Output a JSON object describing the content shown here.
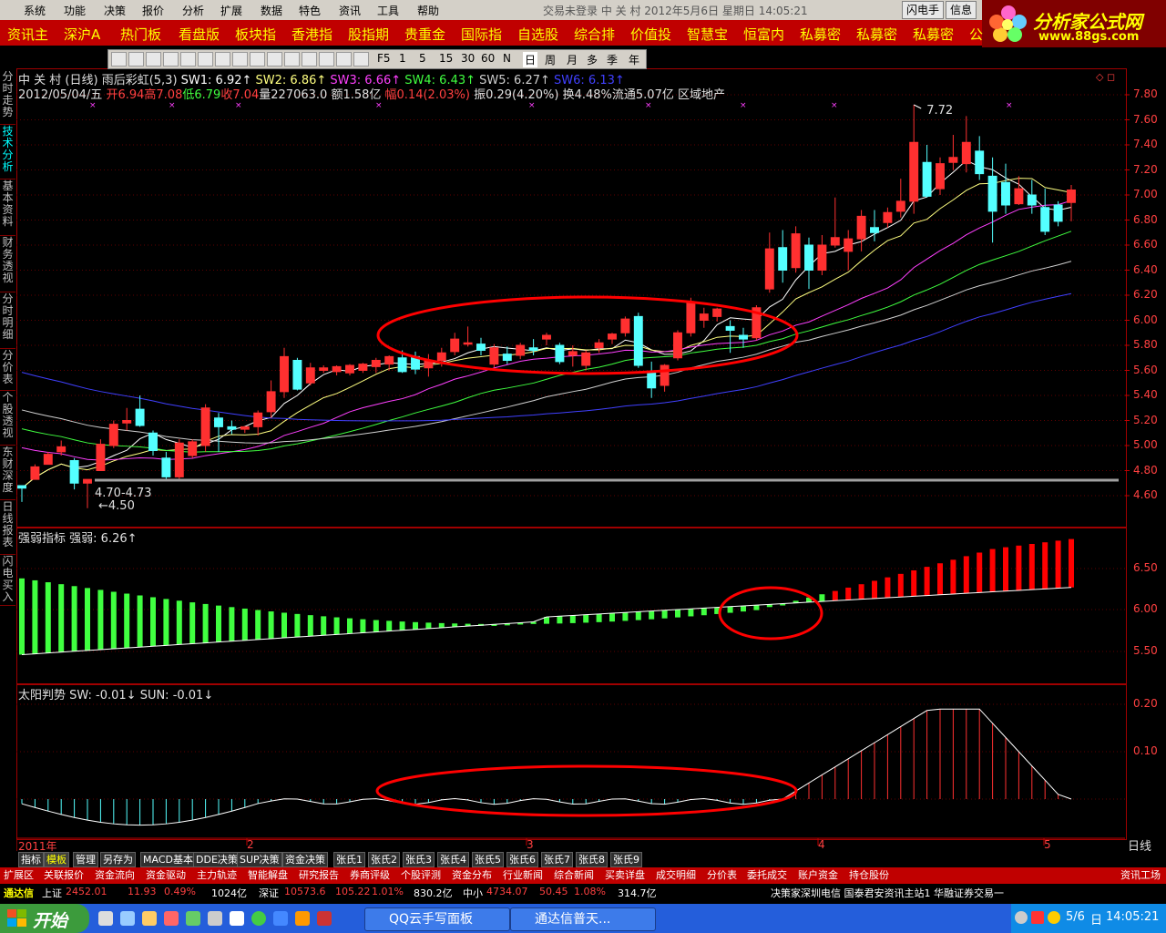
{
  "menu": {
    "items": [
      "系统",
      "功能",
      "决策",
      "报价",
      "分析",
      "扩展",
      "数据",
      "特色",
      "资讯",
      "工具",
      "帮助"
    ],
    "title": "交易未登录  中 关 村  2012年5月6日  星期日  14:05:21",
    "btn_flash": "闪电手",
    "btn_info": "信息"
  },
  "banner": {
    "items": [
      "资讯主",
      "深沪A",
      "热门板",
      "看盘版",
      "板块指",
      "香港指",
      "股指期",
      "贵重金",
      "国际指",
      "自选股",
      "综合排",
      "价值投",
      "智慧宝",
      "恒富内",
      "私募密",
      "私募密",
      "私募密",
      "公"
    ]
  },
  "logo": {
    "name": "分析家公式网",
    "url": "www.88gs.com"
  },
  "left_tabs": [
    "分时走势",
    "技术分析",
    "基本资料",
    "财务透视",
    "分时明细",
    "分价表",
    "个股透视",
    "东财深度",
    "日线报表",
    "闪电买入"
  ],
  "main_info": {
    "line1": {
      "stock": "中 关 村",
      "period": "(日线)",
      "indicator": "雨后彩虹(5,3)",
      "sw1": "SW1: 6.92↑",
      "sw2": "SW2: 6.86↑",
      "sw3": "SW3: 6.66↑",
      "sw4": "SW4: 6.43↑",
      "sw5": "SW5: 6.27↑",
      "sw6": "SW6: 6.13↑"
    },
    "line2": {
      "date": "2012/05/04/五",
      "open": "开6.94",
      "high": "高7.08",
      "low": "低6.79",
      "close": "收7.04",
      "vol": "量227063.0",
      "amount": "额1.58亿",
      "range": "幅0.14(2.03%)",
      "amp": "振0.29(4.20%)",
      "turn": "换4.48%",
      "float": "流通5.07亿",
      "sector": "区域地产"
    },
    "annot_high": "7.72",
    "annot_range": "4.70-4.73",
    "annot_low": "4.50"
  },
  "price_axis": [
    "7.80",
    "7.60",
    "7.40",
    "7.20",
    "7.00",
    "6.80",
    "6.60",
    "6.40",
    "6.20",
    "6.00",
    "5.80",
    "5.60",
    "5.40",
    "5.20",
    "5.00",
    "4.80",
    "4.60"
  ],
  "toolbar": [
    "F5",
    "1",
    "5",
    "15",
    "30",
    "60",
    "N",
    "日",
    "周",
    "月",
    "多",
    "季",
    "年"
  ],
  "strength": {
    "title": "强弱指标",
    "value": "强弱: 6.26↑",
    "axis": [
      "6.50",
      "6.00",
      "5.50"
    ]
  },
  "sun": {
    "title": "太阳判势",
    "sw": "SW: -0.01↓",
    "sun": "SUN: -0.01↓",
    "axis": [
      "0.20",
      "0.10"
    ]
  },
  "xaxis": {
    "labels": [
      "2011年",
      "2",
      "3",
      "4",
      "5"
    ],
    "corner": "日线"
  },
  "tabs1": [
    "指标",
    "模板",
    "管理",
    "另存为",
    "MACD基本",
    "DDE决策",
    "SUP决策",
    "资金决策",
    "张氏1",
    "张氏2",
    "张氏3",
    "张氏4",
    "张氏5",
    "张氏6",
    "张氏7",
    "张氏8",
    "张氏9"
  ],
  "tabs2": [
    "扩展区",
    "关联报价",
    "资金流向",
    "资金驱动",
    "主力轨迹",
    "智能解盘",
    "研究报告",
    "券商评级",
    "个股评测",
    "资金分布",
    "行业新闻",
    "综合新闻",
    "买卖详盘",
    "成交明细",
    "分价表",
    "委托成交",
    "账户资金",
    "持仓股份",
    "资讯工场"
  ],
  "status": {
    "brand": "通达信",
    "sh": "上证",
    "sh_val": "2452.01",
    "sh_chg": "11.93",
    "sh_pct": "0.49%",
    "sh_amt": "1024亿",
    "sz": "深证",
    "sz_val": "10573.6",
    "sz_chg": "105.22",
    "sz_pct": "1.01%",
    "sz_amt": "830.2亿",
    "zx": "中小",
    "zx_val": "4734.07",
    "zx_chg": "50.45",
    "zx_pct": "1.08%",
    "zx_amt": "314.7亿",
    "ticker": "决策家深圳电信  国泰君安资讯主站1  华融证券交易一"
  },
  "taskbar": {
    "start": "开始",
    "task1": "QQ云手写面板",
    "task2": "通达信普天...",
    "date": "5/6",
    "day": "日",
    "time": "14:05:21"
  },
  "colors": {
    "up": "#ff3030",
    "down": "#54ffff",
    "bg": "#000000",
    "grid": "#800000"
  },
  "chart_data": {
    "type": "candlestick",
    "y_range": [
      4.55,
      7.85
    ],
    "candles": [
      [
        4.68,
        4.68,
        4.55,
        4.66
      ],
      [
        4.73,
        4.85,
        4.73,
        4.83
      ],
      [
        4.85,
        4.95,
        4.85,
        4.93
      ],
      [
        4.95,
        5.04,
        4.92,
        4.99
      ],
      [
        4.88,
        4.9,
        4.65,
        4.7
      ],
      [
        4.7,
        4.73,
        4.5,
        4.73
      ],
      [
        4.8,
        5.05,
        4.8,
        5.01
      ],
      [
        5.0,
        5.2,
        4.98,
        5.17
      ],
      [
        5.18,
        5.3,
        5.12,
        5.2
      ],
      [
        5.29,
        5.4,
        5.15,
        5.16
      ],
      [
        5.1,
        5.12,
        4.92,
        4.96
      ],
      [
        4.9,
        4.95,
        4.73,
        4.75
      ],
      [
        4.75,
        5.05,
        4.73,
        5.02
      ],
      [
        4.92,
        5.05,
        4.9,
        5.03
      ],
      [
        5.0,
        5.33,
        4.95,
        5.3
      ],
      [
        5.22,
        5.26,
        4.95,
        5.15
      ],
      [
        5.15,
        5.2,
        5.09,
        5.13
      ],
      [
        5.13,
        5.15,
        5.1,
        5.15
      ],
      [
        5.15,
        5.28,
        5.08,
        5.26
      ],
      [
        5.27,
        5.52,
        5.22,
        5.43
      ],
      [
        5.43,
        5.78,
        5.38,
        5.71
      ],
      [
        5.68,
        5.7,
        5.44,
        5.45
      ],
      [
        5.5,
        5.66,
        5.48,
        5.62
      ],
      [
        5.6,
        5.64,
        5.58,
        5.62
      ],
      [
        5.59,
        5.64,
        5.56,
        5.63
      ],
      [
        5.58,
        5.65,
        5.56,
        5.64
      ],
      [
        5.6,
        5.66,
        5.58,
        5.65
      ],
      [
        5.63,
        5.7,
        5.58,
        5.68
      ],
      [
        5.65,
        5.72,
        5.6,
        5.71
      ],
      [
        5.7,
        5.76,
        5.58,
        5.59
      ],
      [
        5.71,
        5.75,
        5.57,
        5.61
      ],
      [
        5.62,
        5.73,
        5.55,
        5.68
      ],
      [
        5.68,
        5.78,
        5.63,
        5.74
      ],
      [
        5.75,
        5.9,
        5.72,
        5.85
      ],
      [
        5.82,
        5.95,
        5.79,
        5.82
      ],
      [
        5.81,
        5.86,
        5.72,
        5.76
      ],
      [
        5.65,
        5.81,
        5.62,
        5.78
      ],
      [
        5.73,
        5.79,
        5.65,
        5.68
      ],
      [
        5.72,
        5.82,
        5.69,
        5.8
      ],
      [
        5.78,
        5.85,
        5.72,
        5.76
      ],
      [
        5.85,
        5.9,
        5.8,
        5.88
      ],
      [
        5.8,
        5.82,
        5.65,
        5.67
      ],
      [
        5.72,
        5.8,
        5.63,
        5.75
      ],
      [
        5.64,
        5.76,
        5.6,
        5.74
      ],
      [
        5.78,
        5.85,
        5.74,
        5.82
      ],
      [
        5.85,
        5.9,
        5.81,
        5.89
      ],
      [
        5.9,
        6.03,
        5.87,
        6.01
      ],
      [
        6.03,
        6.06,
        5.62,
        5.64
      ],
      [
        5.58,
        5.67,
        5.38,
        5.46
      ],
      [
        5.48,
        5.65,
        5.43,
        5.64
      ],
      [
        5.7,
        5.92,
        5.68,
        5.9
      ],
      [
        5.9,
        6.18,
        5.87,
        6.14
      ],
      [
        6.0,
        6.1,
        5.94,
        6.05
      ],
      [
        6.03,
        6.1,
        5.99,
        6.09
      ],
      [
        5.95,
        6.0,
        5.74,
        5.92
      ],
      [
        5.88,
        5.94,
        5.78,
        5.85
      ],
      [
        5.86,
        6.12,
        5.84,
        6.1
      ],
      [
        6.25,
        6.7,
        6.22,
        6.57
      ],
      [
        6.58,
        6.72,
        6.3,
        6.4
      ],
      [
        6.42,
        6.75,
        6.38,
        6.69
      ],
      [
        6.6,
        6.66,
        6.25,
        6.4
      ],
      [
        6.4,
        6.68,
        6.36,
        6.6
      ],
      [
        6.6,
        6.98,
        6.58,
        6.66
      ],
      [
        6.55,
        6.72,
        6.4,
        6.65
      ],
      [
        6.65,
        6.88,
        6.55,
        6.83
      ],
      [
        6.74,
        6.88,
        6.63,
        6.7
      ],
      [
        6.78,
        6.9,
        6.74,
        6.86
      ],
      [
        6.87,
        7.13,
        6.82,
        6.95
      ],
      [
        6.95,
        7.72,
        6.85,
        7.42
      ],
      [
        7.26,
        7.4,
        6.98,
        6.99
      ],
      [
        7.05,
        7.3,
        7.0,
        7.25
      ],
      [
        7.26,
        7.48,
        7.2,
        7.3
      ],
      [
        7.25,
        7.63,
        7.18,
        7.42
      ],
      [
        7.35,
        7.47,
        7.12,
        7.17
      ],
      [
        7.15,
        7.3,
        6.62,
        6.87
      ],
      [
        7.1,
        7.25,
        6.85,
        6.92
      ],
      [
        6.93,
        7.15,
        6.92,
        7.05
      ],
      [
        7.0,
        7.12,
        6.85,
        6.92
      ],
      [
        6.9,
        7.05,
        6.68,
        6.71
      ],
      [
        6.92,
        6.95,
        6.75,
        6.79
      ],
      [
        6.94,
        7.08,
        6.79,
        7.04
      ]
    ],
    "strength_range": [
      5.35,
      6.85
    ],
    "sun_range": [
      -0.09,
      0.22
    ]
  }
}
